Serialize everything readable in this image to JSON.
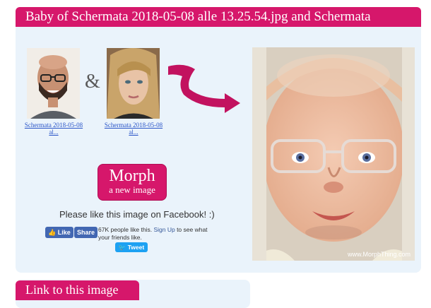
{
  "header": {
    "title": "Baby of Schermata 2018-05-08 alle 13.25.54.jpg and Schermata"
  },
  "parents": [
    {
      "caption_line1": "Schermata 2018-05-08",
      "caption_line2": "al..."
    },
    {
      "caption_line1": "Schermata 2018-05-08",
      "caption_line2": "al..."
    }
  ],
  "ampersand": "&",
  "morph_button": {
    "line1": "Morph",
    "line2": "a new image"
  },
  "facebook": {
    "prompt": "Please like this image on Facebook! :)",
    "like_label": "Like",
    "share_label": "Share",
    "count_text": "67K people like this.",
    "signup_label": "Sign Up",
    "signup_suffix": " to see what your friends like."
  },
  "tweet_label": "Tweet",
  "watermark": "www.MorphThing.com",
  "link_section": {
    "title": "Link to this image"
  },
  "colors": {
    "accent": "#d6176b",
    "panel": "#eaf3fb",
    "facebook": "#4267b2",
    "twitter": "#1da1f2"
  }
}
